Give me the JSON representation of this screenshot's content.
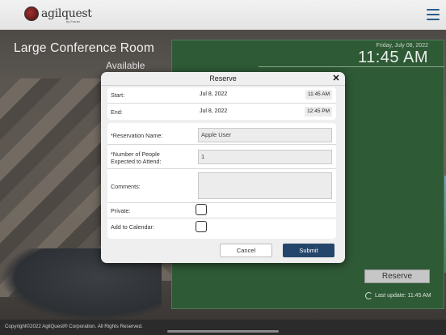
{
  "header": {
    "logo_text": "agilquest",
    "logo_sub": "by Forum",
    "menu_icon": "hamburger-menu-icon"
  },
  "room": {
    "name": "Large Conference Room",
    "status": "Available"
  },
  "panel": {
    "date": "Friday, July 08, 2022",
    "time": "11:45 AM",
    "reserve_label": "Reserve",
    "last_update": "Last update: 11:45 AM",
    "bg_color": "#2f5a36"
  },
  "modal": {
    "title": "Reserve",
    "close_icon": "close-icon",
    "start": {
      "label": "Start:",
      "date": "Jul 8, 2022",
      "time": "11:45 AM"
    },
    "end": {
      "label": "End:",
      "date": "Jul 8, 2022",
      "time": "12:45 PM"
    },
    "reservation_name": {
      "label": "*Reservation Name:",
      "value": "Apple  User"
    },
    "people": {
      "label_line1": "*Number of People",
      "label_line2": "Expected to Attend:",
      "value": "1"
    },
    "comments": {
      "label": "Comments:",
      "value": ""
    },
    "private": {
      "label": "Private:",
      "checked": false
    },
    "calendar": {
      "label": "Add to Calendar:",
      "checked": false
    },
    "cancel_label": "Cancel",
    "submit_label": "Submit",
    "submit_color": "#24466b"
  },
  "footer": {
    "copyright": "Copyright©2022 AgilQuest® Corporation.  All Rights Reserved."
  }
}
